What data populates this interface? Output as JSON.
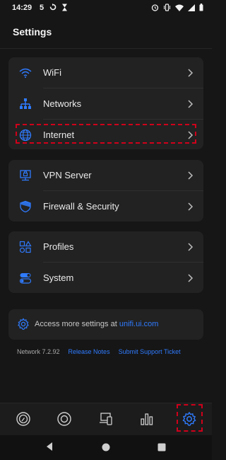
{
  "status_bar": {
    "time": "14:29",
    "notification_text": "5",
    "icons": [
      "notification-5-icon",
      "sync-icon",
      "hourglass-icon",
      "alarm-icon",
      "vibrate-icon",
      "wifi-icon",
      "signal-icon",
      "battery-icon"
    ]
  },
  "header": {
    "title": "Settings"
  },
  "groups": [
    {
      "items": [
        {
          "label": "WiFi",
          "icon": "wifi-icon"
        },
        {
          "label": "Networks",
          "icon": "network-tree-icon"
        },
        {
          "label": "Internet",
          "icon": "globe-icon"
        }
      ]
    },
    {
      "items": [
        {
          "label": "VPN Server",
          "icon": "vpn-icon"
        },
        {
          "label": "Firewall & Security",
          "icon": "shield-icon"
        }
      ]
    },
    {
      "items": [
        {
          "label": "Profiles",
          "icon": "profiles-icon"
        },
        {
          "label": "System",
          "icon": "system-toggle-icon"
        }
      ]
    }
  ],
  "access": {
    "prefix": "Access more settings at ",
    "link": "unifi.ui.com"
  },
  "footer": {
    "version": "Network 7.2.92",
    "release_notes": "Release Notes",
    "support": "Submit Support Ticket"
  },
  "tabs": [
    {
      "name": "dashboard-tab",
      "icon": "dashboard-icon",
      "active": false
    },
    {
      "name": "topology-tab",
      "icon": "target-icon",
      "active": false
    },
    {
      "name": "devices-tab",
      "icon": "devices-icon",
      "active": false
    },
    {
      "name": "stats-tab",
      "icon": "bar-chart-icon",
      "active": false
    },
    {
      "name": "settings-tab",
      "icon": "gear-icon",
      "active": true
    }
  ],
  "colors": {
    "accent": "#2f7bff",
    "highlight": "#d0001a",
    "card": "#222222",
    "background": "#161616"
  }
}
